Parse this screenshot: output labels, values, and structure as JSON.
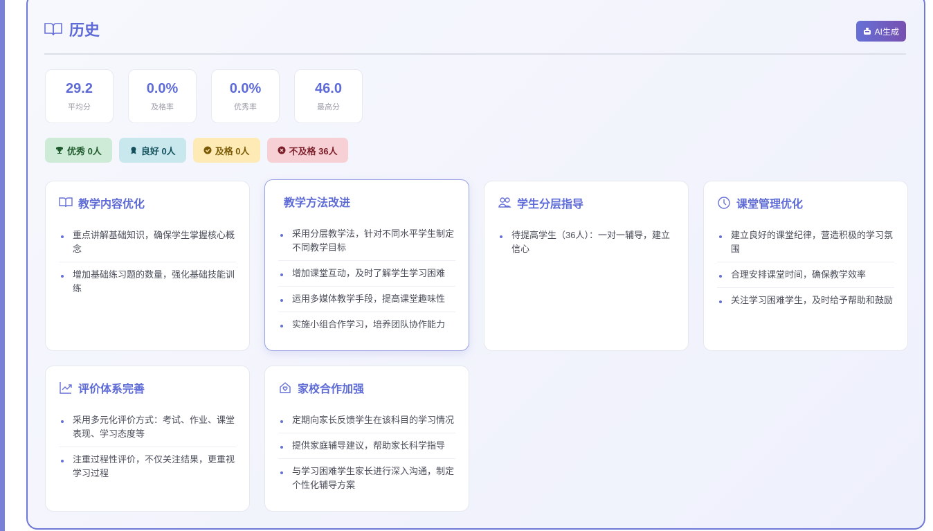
{
  "subject": "历史",
  "ai_button": "AI生成",
  "stats": [
    {
      "value": "29.2",
      "label": "平均分"
    },
    {
      "value": "0.0%",
      "label": "及格率"
    },
    {
      "value": "0.0%",
      "label": "优秀率"
    },
    {
      "value": "46.0",
      "label": "最高分"
    }
  ],
  "badges": [
    {
      "label": "优秀 0人",
      "icon": "trophy-icon",
      "bg": "#cdebd6",
      "color": "#1f5a2d"
    },
    {
      "label": "良好 0人",
      "icon": "award-icon",
      "bg": "#c8e8ee",
      "color": "#13505c"
    },
    {
      "label": "及格 0人",
      "icon": "check-circle-icon",
      "bg": "#fdeab5",
      "color": "#7a5a05"
    },
    {
      "label": "不及格 36人",
      "icon": "x-circle-icon",
      "bg": "#f6d0d4",
      "color": "#7a1d28"
    }
  ],
  "cards": [
    {
      "title": "教学内容优化",
      "icon": "book-icon",
      "items": [
        "重点讲解基础知识，确保学生掌握核心概念",
        "增加基础练习题的数量，强化基础技能训练"
      ]
    },
    {
      "title": "教学方法改进",
      "icon": "",
      "items": [
        "采用分层教学法，针对不同水平学生制定不同教学目标",
        "增加课堂互动，及时了解学生学习困难",
        "运用多媒体教学手段，提高课堂趣味性",
        "实施小组合作学习，培养团队协作能力"
      ]
    },
    {
      "title": "学生分层指导",
      "icon": "users-icon",
      "items": [
        "待提高学生（36人）：一对一辅导，建立信心"
      ]
    },
    {
      "title": "课堂管理优化",
      "icon": "clock-icon",
      "items": [
        "建立良好的课堂纪律，营造积极的学习氛围",
        "合理安排课堂时间，确保教学效率",
        "关注学习困难学生，及时给予帮助和鼓励"
      ]
    },
    {
      "title": "评价体系完善",
      "icon": "chart-line-icon",
      "items": [
        "采用多元化评价方式：考试、作业、课堂表现、学习态度等",
        "注重过程性评价，不仅关注结果，更重视学习过程"
      ]
    },
    {
      "title": "家校合作加强",
      "icon": "home-heart-icon",
      "items": [
        "定期向家长反馈学生在该科目的学习情况",
        "提供家庭辅导建议，帮助家长科学指导",
        "与学习困难学生家长进行深入沟通，制定个性化辅导方案"
      ]
    }
  ]
}
